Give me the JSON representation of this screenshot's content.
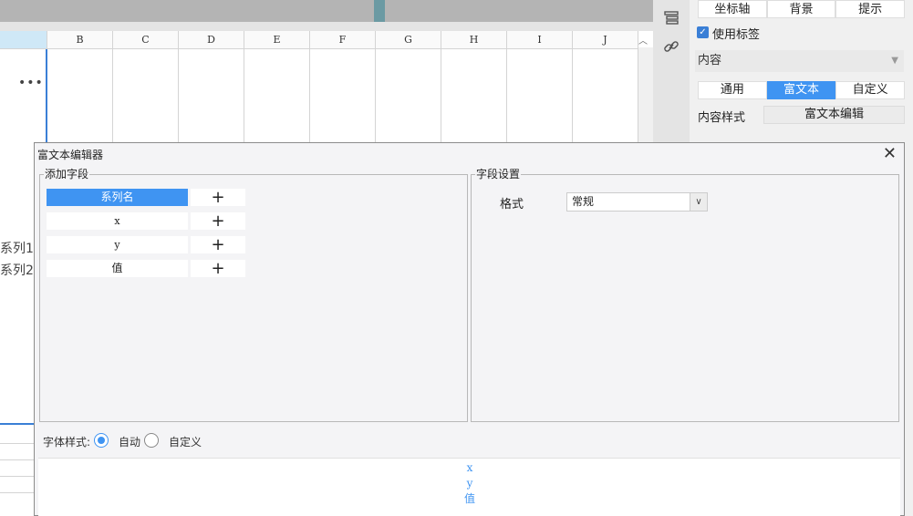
{
  "sheet": {
    "columns": [
      "B",
      "C",
      "D",
      "E",
      "F",
      "G",
      "H",
      "I",
      "J"
    ],
    "more_icon": "more-dots-icon",
    "series_labels": [
      "系列1",
      "系列2"
    ]
  },
  "right_panel": {
    "tabs": [
      "坐标轴",
      "背景",
      "提示"
    ],
    "use_label_checkbox": "使用标签",
    "content_select": "内容",
    "content_modes": [
      "通用",
      "富文本",
      "自定义"
    ],
    "content_style_label": "内容样式",
    "rich_text_edit_button": "富文本编辑",
    "icons": [
      "layers-icon",
      "link-icon"
    ]
  },
  "modal": {
    "title": "富文本编辑器",
    "close_icon": "close-icon",
    "add_field_group": "添加字段",
    "fields": [
      "系列名",
      "x",
      "y",
      "值"
    ],
    "field_settings_group": "字段设置",
    "format_label": "格式",
    "format_value": "常规",
    "font_style_label": "字体样式:",
    "font_style_options": [
      "自动",
      "自定义"
    ],
    "font_style_selected": "自动",
    "preview_lines": [
      "x",
      "y",
      "值"
    ]
  },
  "colors": {
    "accent": "#3f94f2",
    "selection_border": "#3a7fd6",
    "top_strip": "#b4b4b4",
    "teal_marker": "#6b9aa3"
  }
}
